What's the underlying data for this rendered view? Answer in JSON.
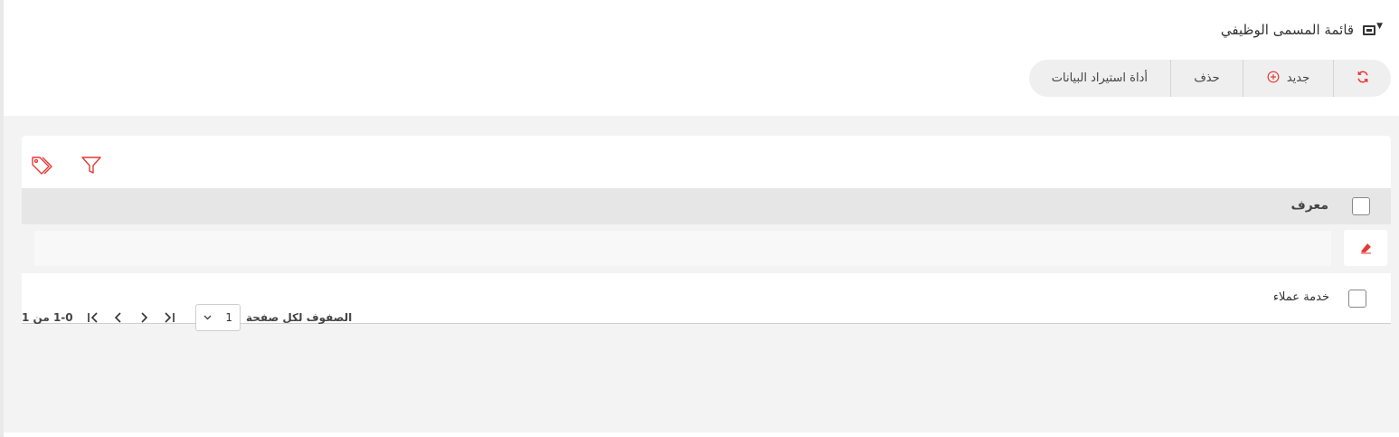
{
  "header": {
    "title": "قائمة المسمى الوظيفي",
    "view_icon": "monitor-icon",
    "view_caret_icon": "caret-down-icon"
  },
  "toolbar": {
    "refresh_icon": "refresh-icon",
    "new_label": "جديد",
    "new_icon": "add-circle-icon",
    "delete_label": "حذف",
    "import_label": "أداة استيراد البيانات"
  },
  "grid": {
    "tools": [
      "tags-icon",
      "filter-icon"
    ],
    "columns": [
      {
        "label": "معرف"
      }
    ],
    "filter_value": "",
    "clear_icon": "eraser-icon",
    "rows": [
      {
        "label": "خدمة عملاء"
      }
    ]
  },
  "pagination": {
    "count_text": "1-0 من 1",
    "rows_per_page_label": "الصفوف لكل صفحة",
    "rows_per_page_value": "1"
  },
  "colors": {
    "accent": "#e53935",
    "header_bg": "#e6e6e6",
    "toolbar_bg": "#efefef",
    "content_bg": "#f3f3f3"
  }
}
